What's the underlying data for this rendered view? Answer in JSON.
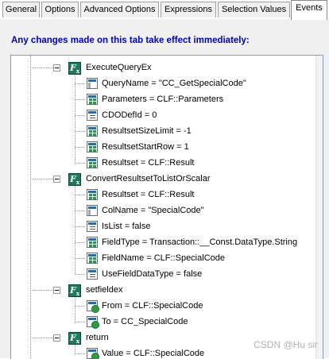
{
  "tabs": [
    {
      "label": "General",
      "active": false
    },
    {
      "label": "Options",
      "active": false
    },
    {
      "label": "Advanced Options",
      "active": false
    },
    {
      "label": "Expressions",
      "active": false
    },
    {
      "label": "Selection Values",
      "active": false
    },
    {
      "label": "Events",
      "active": true
    }
  ],
  "notice": "Any changes made on this tab take effect immediately:",
  "tree": {
    "nodes": [
      {
        "label": "ExecuteQueryEx",
        "icon": "function-icon",
        "children": [
          {
            "label": "QueryName = \"CC_GetSpecialCode\"",
            "icon": "table-param-icon"
          },
          {
            "label": "Parameters = CLF::Parameters",
            "icon": "grid-param-icon"
          },
          {
            "label": "CDODefId = 0",
            "icon": "plain-param-icon"
          },
          {
            "label": "ResultsetSizeLimit = -1",
            "icon": "grid-param-icon"
          },
          {
            "label": "ResultsetStartRow = 1",
            "icon": "grid-param-icon"
          },
          {
            "label": "Resultset = CLF::Result",
            "icon": "grid-param-icon"
          }
        ]
      },
      {
        "label": "ConvertResultsetToListOrScalar",
        "icon": "function-icon",
        "children": [
          {
            "label": "Resultset = CLF::Result",
            "icon": "grid-param-icon"
          },
          {
            "label": "ColName = \"SpecialCode\"",
            "icon": "table-param-icon"
          },
          {
            "label": "IsList = false",
            "icon": "plain-param-icon"
          },
          {
            "label": "FieldType = Transaction::__Const.DataType.String",
            "icon": "grid-param-icon"
          },
          {
            "label": "FieldName = CLF::SpecialCode",
            "icon": "grid-param-icon"
          },
          {
            "label": "UseFieldDataType = false",
            "icon": "plain-param-icon"
          }
        ]
      },
      {
        "label": "setfieldex",
        "icon": "function-icon",
        "children": [
          {
            "label": "From = CLF::SpecialCode",
            "icon": "out-param-icon"
          },
          {
            "label": "To = CC_SpecialCode",
            "icon": "out-param-icon"
          }
        ]
      },
      {
        "label": "return",
        "icon": "function-icon",
        "children": [
          {
            "label": "Value = CLF::SpecialCode",
            "icon": "out-param-icon"
          }
        ]
      }
    ]
  },
  "watermark": "CSDN @Hu  sir"
}
